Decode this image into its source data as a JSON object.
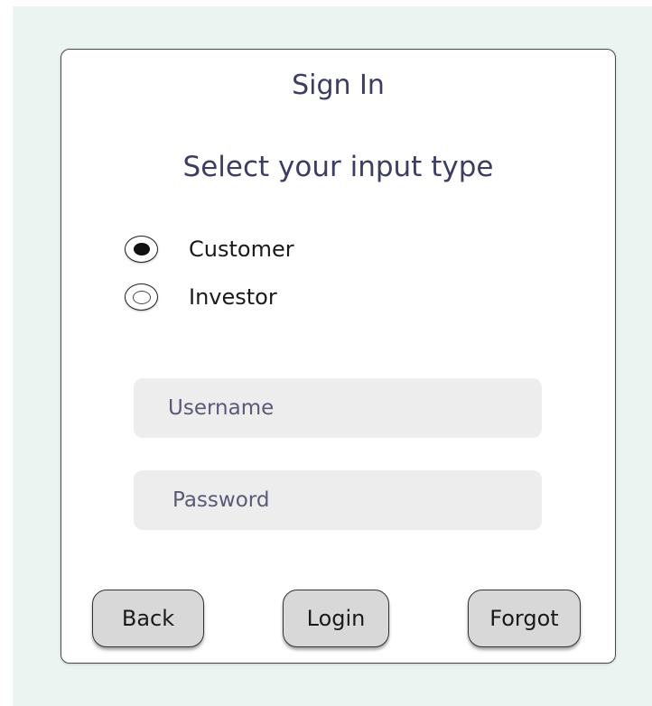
{
  "form": {
    "title": "Sign In",
    "subtitle": "Select your input type",
    "input_types": [
      {
        "label": "Customer",
        "selected": true
      },
      {
        "label": "Investor",
        "selected": false
      }
    ],
    "username": {
      "placeholder": "Username",
      "value": ""
    },
    "password": {
      "placeholder": "Password",
      "value": ""
    },
    "buttons": {
      "back": "Back",
      "login": "Login",
      "forgot": "Forgot"
    }
  },
  "colors": {
    "background": "#ebf4f0",
    "card": "#ffffff",
    "heading_text": "#3d3d63",
    "field_background": "#ededed",
    "button_background": "#d8d8d8"
  }
}
